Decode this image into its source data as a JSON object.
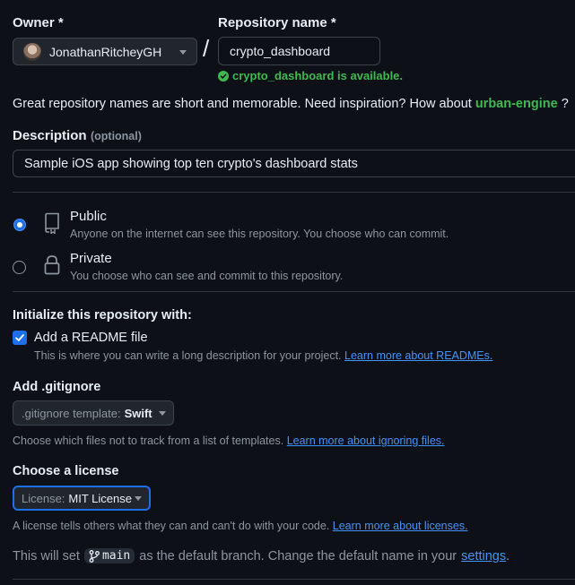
{
  "owner": {
    "label": "Owner *",
    "value": "JonathanRitcheyGH"
  },
  "separator": "/",
  "repo": {
    "label": "Repository name *",
    "value": "crypto_dashboard",
    "availability": "crypto_dashboard is available."
  },
  "suggestion": {
    "text": "Great repository names are short and memorable. Need inspiration? How about",
    "name": "urban-engine",
    "end": "?"
  },
  "description": {
    "label": "Description",
    "optional": "(optional)",
    "value": "Sample iOS app showing top ten crypto's dashboard stats"
  },
  "visibility": {
    "public": {
      "title": "Public",
      "desc": "Anyone on the internet can see this repository. You choose who can commit.",
      "selected": true
    },
    "private": {
      "title": "Private",
      "desc": "You choose who can see and commit to this repository.",
      "selected": false
    }
  },
  "init": {
    "heading": "Initialize this repository with:",
    "readme_label": "Add a README file",
    "readme_checked": true,
    "readme_desc": "This is where you can write a long description for your project.",
    "readme_link": "Learn more about READMEs."
  },
  "gitignore": {
    "heading": "Add .gitignore",
    "prefix": ".gitignore template:",
    "value": "Swift",
    "desc": "Choose which files not to track from a list of templates.",
    "link": "Learn more about ignoring files."
  },
  "license": {
    "heading": "Choose a license",
    "prefix": "License:",
    "value": "MIT License",
    "desc": "A license tells others what they can and can't do with your code.",
    "link": "Learn more about licenses."
  },
  "branch": {
    "before": "This will set",
    "name": "main",
    "after": "as the default branch. Change the default name in your",
    "link": "settings",
    "end": "."
  },
  "colors": {
    "background": "#0d1117",
    "success": "#3fb950",
    "link": "#4493f8",
    "accent": "#1f6feb"
  }
}
